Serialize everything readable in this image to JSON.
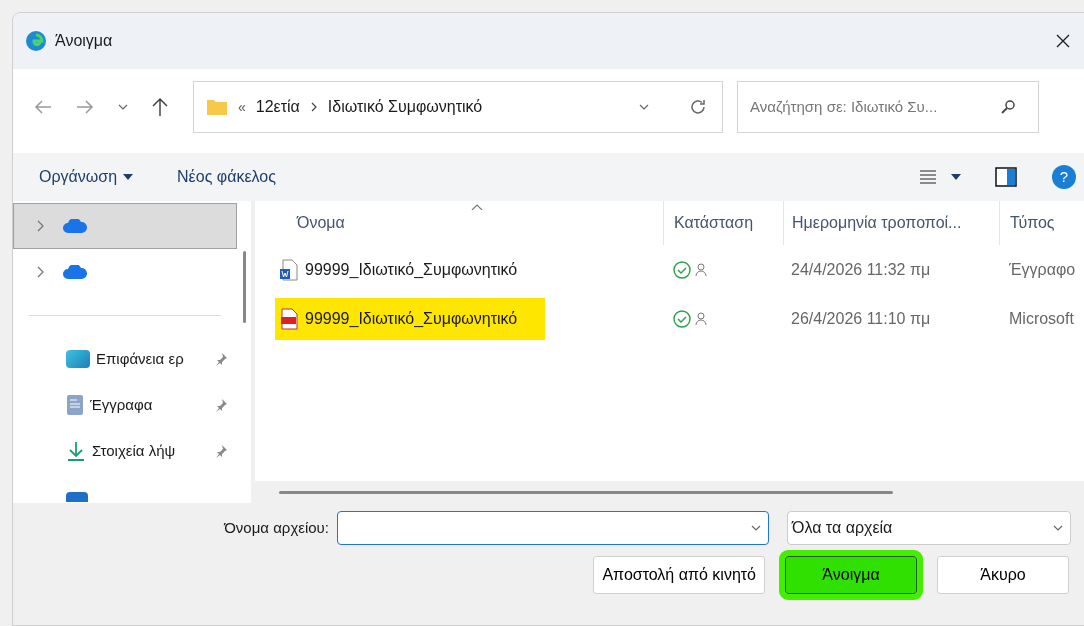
{
  "window": {
    "title": "Άνοιγμα"
  },
  "address": {
    "crumbs": [
      {
        "label": "«"
      },
      {
        "label": "12ετία"
      },
      {
        "label": "Ιδιωτικό Συμφωνητικό"
      }
    ]
  },
  "search": {
    "placeholder": "Αναζήτηση σε: Ιδιωτικό Συ..."
  },
  "help": "?",
  "commands": [
    {
      "label": "Οργάνωση",
      "dropdown": true
    },
    {
      "label": "Νέος φάκελος",
      "dropdown": false
    }
  ],
  "sidebar": {
    "items": [
      {
        "kind": "cloud",
        "selected": true
      },
      {
        "kind": "cloud",
        "selected": false
      },
      {
        "kind": "desktop",
        "selected": false,
        "label": "Επιφάνεια ερ"
      },
      {
        "kind": "documents",
        "selected": false,
        "label": "Έγγραφα"
      },
      {
        "kind": "downloads",
        "selected": false,
        "label": "Στοιχεία λήψ"
      },
      {
        "kind": "pictures",
        "selected": false
      }
    ]
  },
  "table": {
    "columns": [
      "Όνομα",
      "Κατάσταση",
      "Ημερομηνία τροποποί...",
      "Τύπος"
    ],
    "rows": [
      {
        "kind": "word",
        "name": "99999_Ιδιωτικό_Συμφωνητικό",
        "date": "24/4/2026 11:32 πμ",
        "type": "Έγγραφο",
        "highlighted": false
      },
      {
        "kind": "pdf",
        "name": "99999_Ιδιωτικό_Συμφωνητικό",
        "date": "26/4/2026 11:10 πμ",
        "type": "Microsoft",
        "highlighted": true
      }
    ]
  },
  "footer": {
    "filename_label": "Όνομα αρχείου:",
    "filter": "Όλα τα αρχεία",
    "buttons": [
      {
        "label": "Αποστολή από κινητό",
        "highlighted": false
      },
      {
        "label": "Άνοιγμα",
        "highlighted": true
      },
      {
        "label": "Άκυρο",
        "highlighted": false
      }
    ]
  }
}
